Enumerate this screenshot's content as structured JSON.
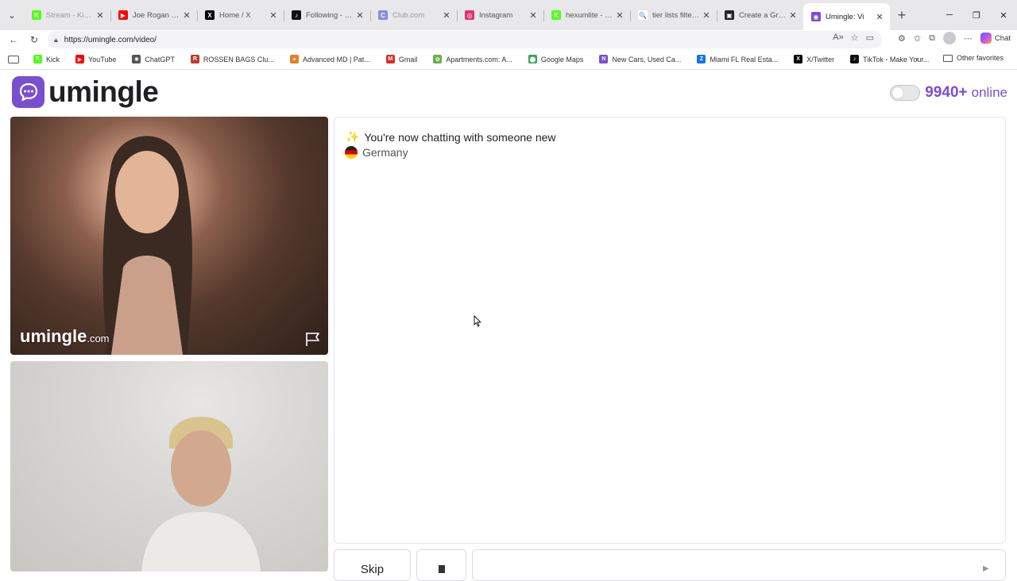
{
  "browser": {
    "tabs": [
      {
        "title": "Stream - Kick Da",
        "fav": "K",
        "color": "#53fc18",
        "faded": true
      },
      {
        "title": "Joe Rogan - He L",
        "fav": "▶",
        "color": "#ff0000"
      },
      {
        "title": "Home / X",
        "fav": "X",
        "color": "#000000"
      },
      {
        "title": "Following - Watc",
        "fav": "♪",
        "color": "#111111"
      },
      {
        "title": "Club.com",
        "fav": "C",
        "color": "#8b8bdc",
        "faded": true
      },
      {
        "title": "Instagram",
        "fav": "◎",
        "color": "#e1306c"
      },
      {
        "title": "hexumlite - Watc",
        "fav": "K",
        "color": "#53fc18"
      },
      {
        "title": "tier lists filters - S",
        "fav": "🔍",
        "color": "#ffffff"
      },
      {
        "title": "Create a Greater",
        "fav": "▣",
        "color": "#222222"
      },
      {
        "title": "Umingle: Vi",
        "fav": "◉",
        "color": "#7a4fcf",
        "active": true
      }
    ],
    "url": "https://umingle.com/video/",
    "chat_label": "Chat",
    "bookmarks": [
      {
        "label": "Kick",
        "fav": "K",
        "color": "#53fc18"
      },
      {
        "label": "YouTube",
        "fav": "▶",
        "color": "#ff0000"
      },
      {
        "label": "ChatGPT",
        "fav": "✺",
        "color": "#555555"
      },
      {
        "label": "ROSSEN BAGS Clu...",
        "fav": "R",
        "color": "#c0392b"
      },
      {
        "label": "Advanced MD | Pat...",
        "fav": "✦",
        "color": "#e67e22"
      },
      {
        "label": "Gmail",
        "fav": "M",
        "color": "#d93025"
      },
      {
        "label": "Apartments.com: A...",
        "fav": "✿",
        "color": "#6ab04c"
      },
      {
        "label": "Google Maps",
        "fav": "⬤",
        "color": "#34a853"
      },
      {
        "label": "New Cars, Used Ca...",
        "fav": "N",
        "color": "#7a4fcf"
      },
      {
        "label": "Miami FL Real Esta...",
        "fav": "Z",
        "color": "#1277e1"
      },
      {
        "label": "X/Twitter",
        "fav": "X",
        "color": "#000000"
      },
      {
        "label": "TikTok - Make Your...",
        "fav": "♪",
        "color": "#111111"
      }
    ],
    "other_favorites": "Other favorites"
  },
  "site": {
    "logo_text": "umingle",
    "online_count": "9940+",
    "online_label": "online",
    "brand_color": "#7a4fcf"
  },
  "video": {
    "watermark_name": "umingle",
    "watermark_domain": ".com"
  },
  "chat": {
    "status_message": "You're now chatting with someone new",
    "country": "Germany"
  },
  "controls": {
    "skip_label": "Skip",
    "input_value": ""
  }
}
